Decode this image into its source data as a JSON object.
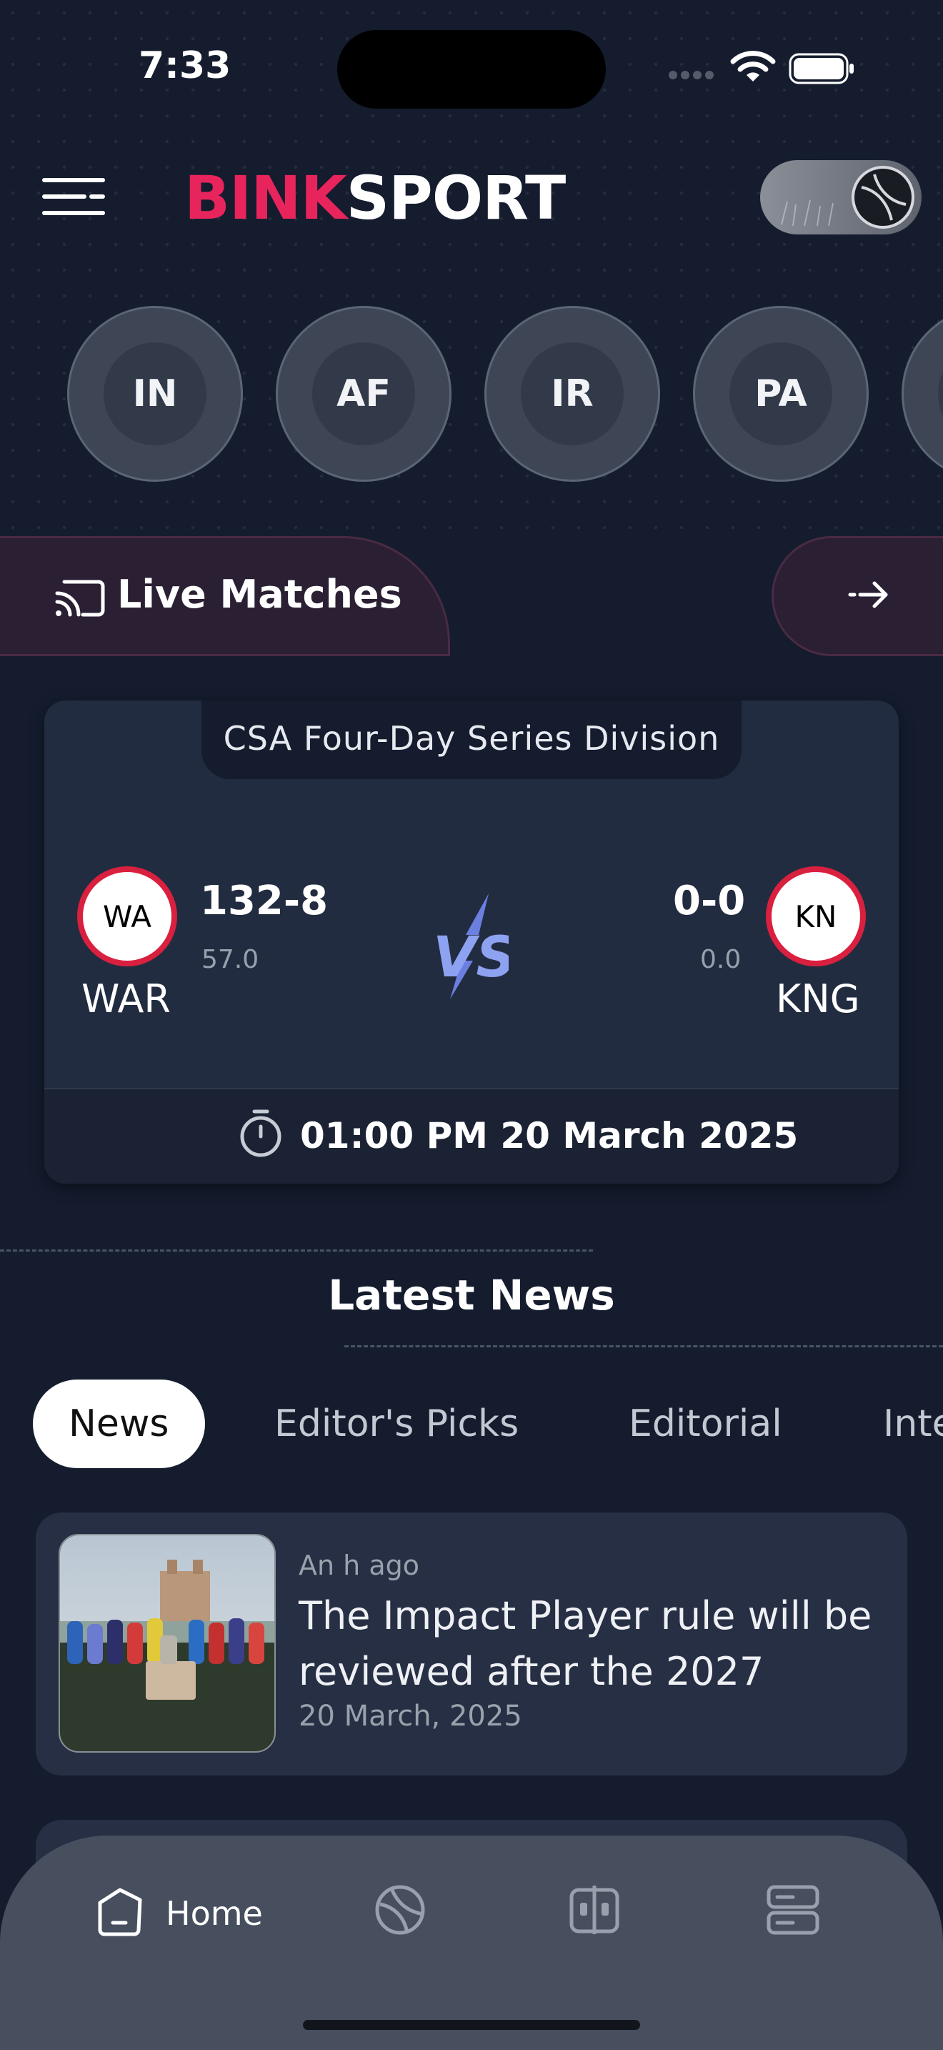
{
  "status_bar": {
    "time": "7:33"
  },
  "header": {
    "logo_part1": "BINK",
    "logo_part2": "SPORT",
    "colors": {
      "accent": "#e8245c",
      "background": "#141c2e"
    }
  },
  "countries": [
    "IN",
    "AF",
    "IR",
    "PA"
  ],
  "live": {
    "label": "Live Matches"
  },
  "match": {
    "series": "CSA Four-Day Series Division",
    "team1": {
      "abbr": "WA",
      "name": "WAR",
      "score": "132-8",
      "overs": "57.0"
    },
    "team2": {
      "abbr": "KN",
      "name": "KNG",
      "score": "0-0",
      "overs": "0.0"
    },
    "time": "01:00 PM 20 March 2025"
  },
  "news": {
    "heading": "Latest News",
    "tabs": [
      "News",
      "Editor's Picks",
      "Editorial",
      "Inte"
    ],
    "items": [
      {
        "time_ago": "An h ago",
        "title": "The Impact Player rule will be reviewed after the 2027",
        "date": "20 March, 2025"
      }
    ]
  },
  "nav": {
    "home_label": "Home"
  }
}
